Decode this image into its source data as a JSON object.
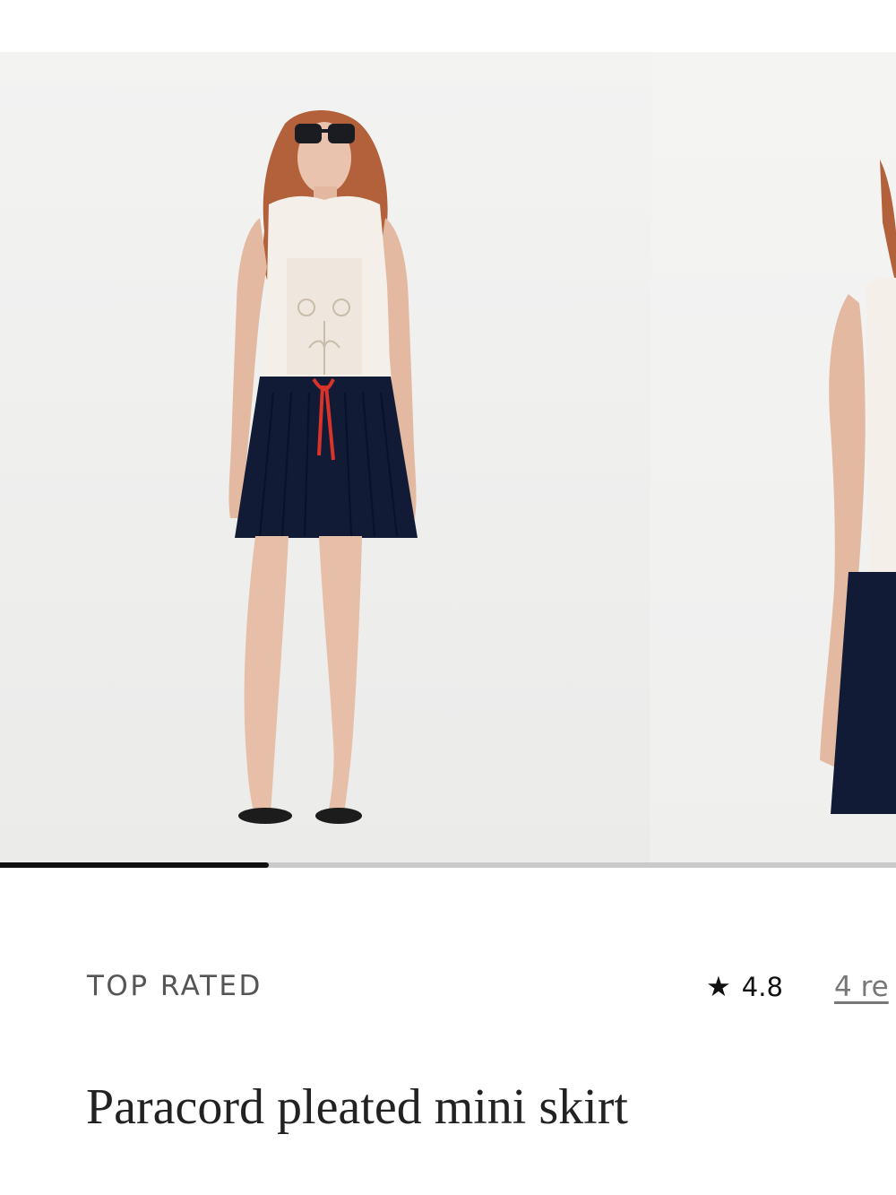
{
  "carousel": {
    "slides": [
      {
        "label": "Model wearing white crochet top and navy pleated mini skirt, front view"
      },
      {
        "label": "Model wearing the skirt, side view"
      }
    ],
    "progress": 0.3
  },
  "product": {
    "badge": "TOP RATED",
    "rating": "4.8",
    "star_icon": "★",
    "reviews_link": "4 re",
    "title": "Paracord pleated mini skirt"
  },
  "colors": {
    "skirt_navy": "#101a33",
    "drawcord_red": "#d9332a",
    "text_gray": "#555555"
  }
}
